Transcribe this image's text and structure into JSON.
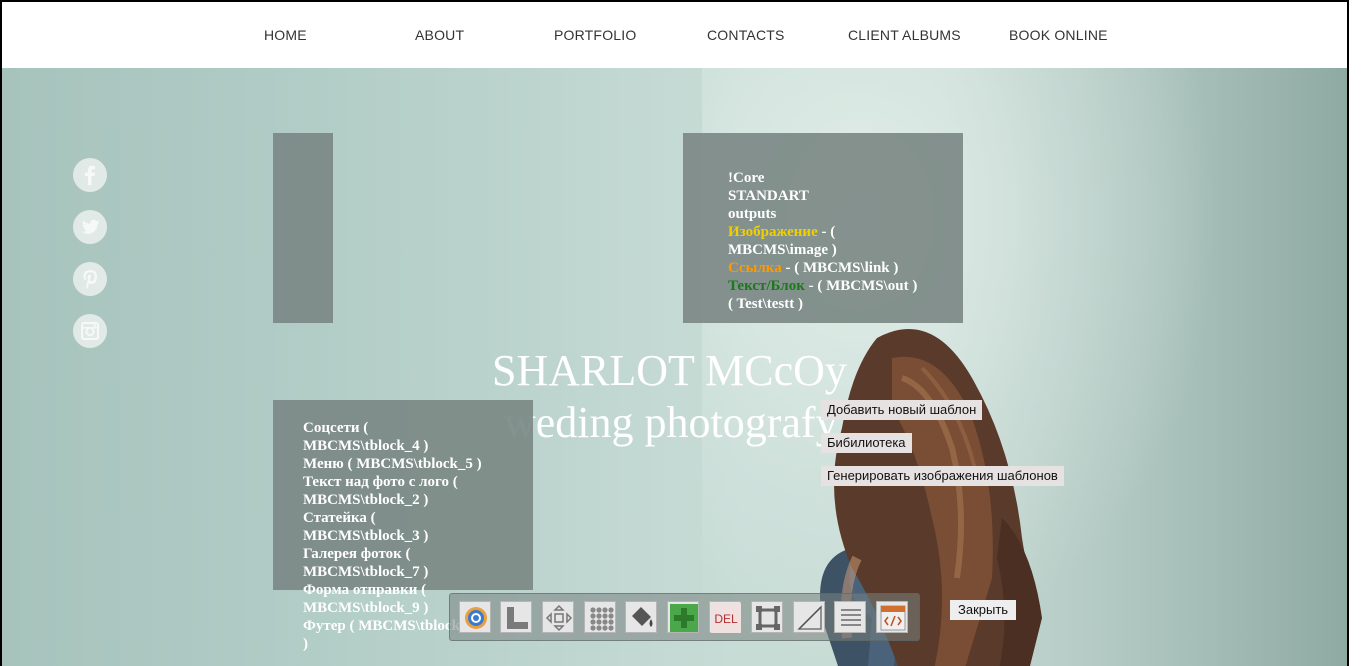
{
  "nav": {
    "items": [
      "HOME",
      "ABOUT",
      "PORTFOLIO",
      "CONTACTS",
      "CLIENT ALBUMS",
      "BOOK ONLINE"
    ]
  },
  "social": [
    "facebook-icon",
    "twitter-icon",
    "pinterest-icon",
    "instagram-icon"
  ],
  "right_panel": {
    "line1": "!Core",
    "line2": "STANDART",
    "line3": "outputs",
    "image_label": "Изображение",
    "image_value": " - ( MBCMS\\image )",
    "link_label": "Ссылка",
    "link_value": " - ( MBCMS\\link )",
    "text_label": "Текст/Блок",
    "text_value": " - ( MBCMS\\out )",
    "test_value": " ( Test\\testt )",
    "colors": {
      "image": "#f0d000",
      "link": "#ff9900",
      "text": "#1a7a1a"
    }
  },
  "left_panel": {
    "lines": [
      "Соцсети ( MBCMS\\tblock_4 )",
      "Меню ( MBCMS\\tblock_5 )",
      "Текст над фото с лого ( MBCMS\\tblock_2 )",
      "Статейка ( MBCMS\\tblock_3 )",
      "Галерея фоток ( MBCMS\\tblock_7 )",
      "Форма отправки ( MBCMS\\tblock_9 )",
      "Футер ( MBCMS\\tblock_8 )"
    ]
  },
  "brand": {
    "title": "SHARLOT MCcOy",
    "subtitle": "weding photografy"
  },
  "context_menu": {
    "add_template": "Добавить новый шаблон",
    "library": "Бибилиотека",
    "generate": "Генерировать изображения шаблонов"
  },
  "toolbar": {
    "tools": [
      "settings-icon",
      "layout-icon",
      "move-icon",
      "grid-icon",
      "paint-bucket-icon",
      "add-icon",
      "delete-icon",
      "frame-icon",
      "angle-icon",
      "list-icon",
      "code-icon"
    ],
    "del_label": "DEL",
    "close_label": "Закрыть"
  }
}
